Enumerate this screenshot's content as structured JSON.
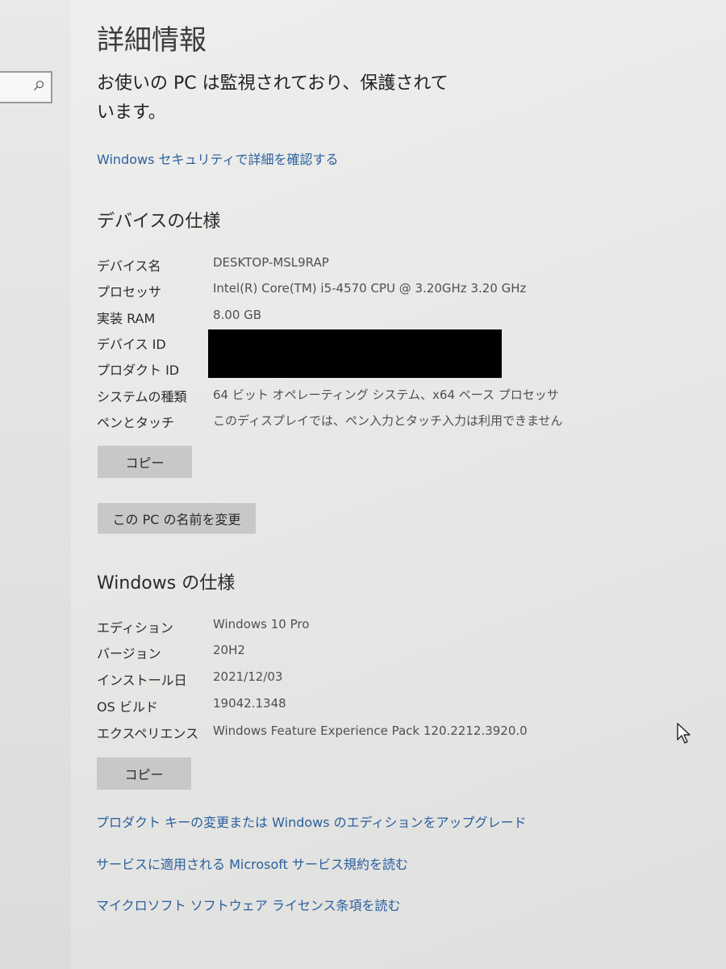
{
  "page": {
    "title": "詳細情報",
    "status": "お使いの PC は監視されており、保護されています。",
    "security_link": "Windows セキュリティで詳細を確認する"
  },
  "device_specs": {
    "heading": "デバイスの仕様",
    "rows": [
      {
        "label": "デバイス名",
        "value": "DESKTOP-MSL9RAP"
      },
      {
        "label": "プロセッサ",
        "value": "Intel(R) Core(TM) i5-4570 CPU @ 3.20GHz   3.20 GHz"
      },
      {
        "label": "実装 RAM",
        "value": "8.00 GB"
      },
      {
        "label": "デバイス ID",
        "value": ""
      },
      {
        "label": "プロダクト ID",
        "value": ""
      },
      {
        "label": "システムの種類",
        "value": "64 ビット オペレーティング システム、x64 ベース プロセッサ"
      },
      {
        "label": "ペンとタッチ",
        "value": "このディスプレイでは、ペン入力とタッチ入力は利用できません"
      }
    ],
    "copy_button": "コピー",
    "rename_button": "この PC の名前を変更"
  },
  "windows_specs": {
    "heading": "Windows の仕様",
    "rows": [
      {
        "label": "エディション",
        "value": "Windows 10 Pro"
      },
      {
        "label": "バージョン",
        "value": "20H2"
      },
      {
        "label": "インストール日",
        "value": "2021/12/03"
      },
      {
        "label": "OS ビルド",
        "value": "19042.1348"
      },
      {
        "label": "エクスペリエンス",
        "value": "Windows Feature Experience Pack 120.2212.3920.0"
      }
    ],
    "copy_button": "コピー"
  },
  "links": {
    "product_key": "プロダクト キーの変更または Windows のエディションをアップグレード",
    "service_agreement": "サービスに適用される Microsoft サービス規約を読む",
    "license_terms": "マイクロソフト ソフトウェア ライセンス条項を読む"
  },
  "icons": {
    "search": "search-icon",
    "cursor": "mouse-cursor-icon"
  },
  "colors": {
    "link": "#2a5f9e",
    "button": "#c8c8c6",
    "background": "#e9e9e7"
  }
}
